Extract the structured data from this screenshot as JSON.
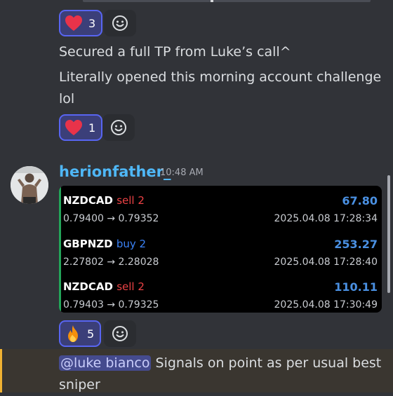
{
  "reactions": {
    "first": {
      "emoji": "heart",
      "count": "3"
    },
    "second": {
      "emoji": "heart",
      "count": "1"
    },
    "third": {
      "emoji": "fire",
      "count": "5"
    }
  },
  "messages": {
    "line1": "Secured a full TP from Luke’s call^",
    "line2": "Literally opened this morning account challenge lol"
  },
  "post": {
    "username": "herionfather_",
    "timestamp": "10:48 AM",
    "trades": [
      {
        "pair": "NZDCAD",
        "side": "sell 2",
        "prices": "0.79400 → 0.79352",
        "profit": "67.80",
        "date": "2025.04.08 17:28:34"
      },
      {
        "pair": "GBPNZD",
        "side": "buy 2",
        "prices": "2.27802 → 2.28028",
        "profit": "253.27",
        "date": "2025.04.08 17:28:40"
      },
      {
        "pair": "NZDCAD",
        "side": "sell 2",
        "prices": "0.79403 → 0.79325",
        "profit": "110.11",
        "date": "2025.04.08 17:30:49"
      }
    ]
  },
  "reply": {
    "mention": "@luke bianco",
    "text": " Signals on point as per usual best sniper"
  },
  "colors": {
    "accent": "#5865f2",
    "username": "#4fb7f6",
    "sell": "#ed4245",
    "buy": "#3b82f6",
    "profit": "#4a90e2",
    "embed_bar": "#23a559",
    "highlight_bar": "#f0b232"
  }
}
